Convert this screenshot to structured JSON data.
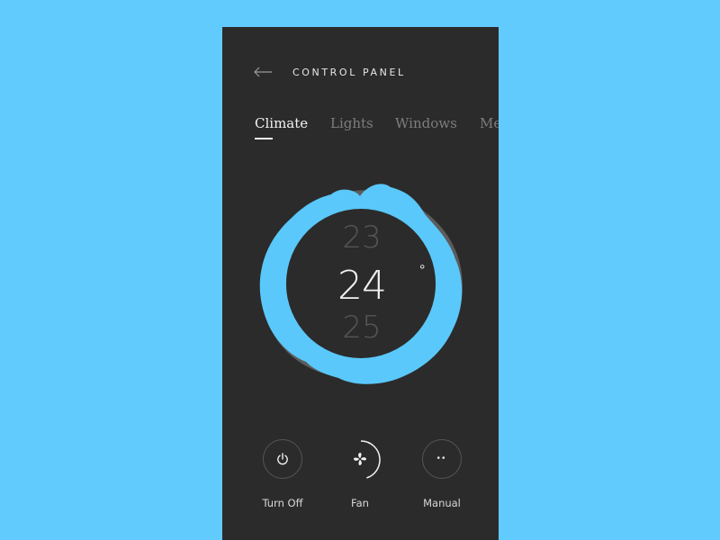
{
  "header": {
    "title": "CONTROL PANEL",
    "back_icon": "arrow-left-icon"
  },
  "tabs": [
    {
      "label": "Climate",
      "active": true
    },
    {
      "label": "Lights",
      "active": false
    },
    {
      "label": "Windows",
      "active": false
    },
    {
      "label": "Media",
      "active": false
    }
  ],
  "thermostat": {
    "previous_value": "23",
    "current_value": "24",
    "next_value": "25",
    "unit_symbol": "°"
  },
  "controls": [
    {
      "label": "Turn Off",
      "icon": "power-icon"
    },
    {
      "label": "Fan",
      "icon": "fan-icon",
      "progress": 0.45
    },
    {
      "label": "Manual",
      "icon": "dots-icon"
    }
  ],
  "colors": {
    "background": "#62cbfd",
    "panel": "#2b2b2b",
    "accent": "#5ac8fa"
  }
}
